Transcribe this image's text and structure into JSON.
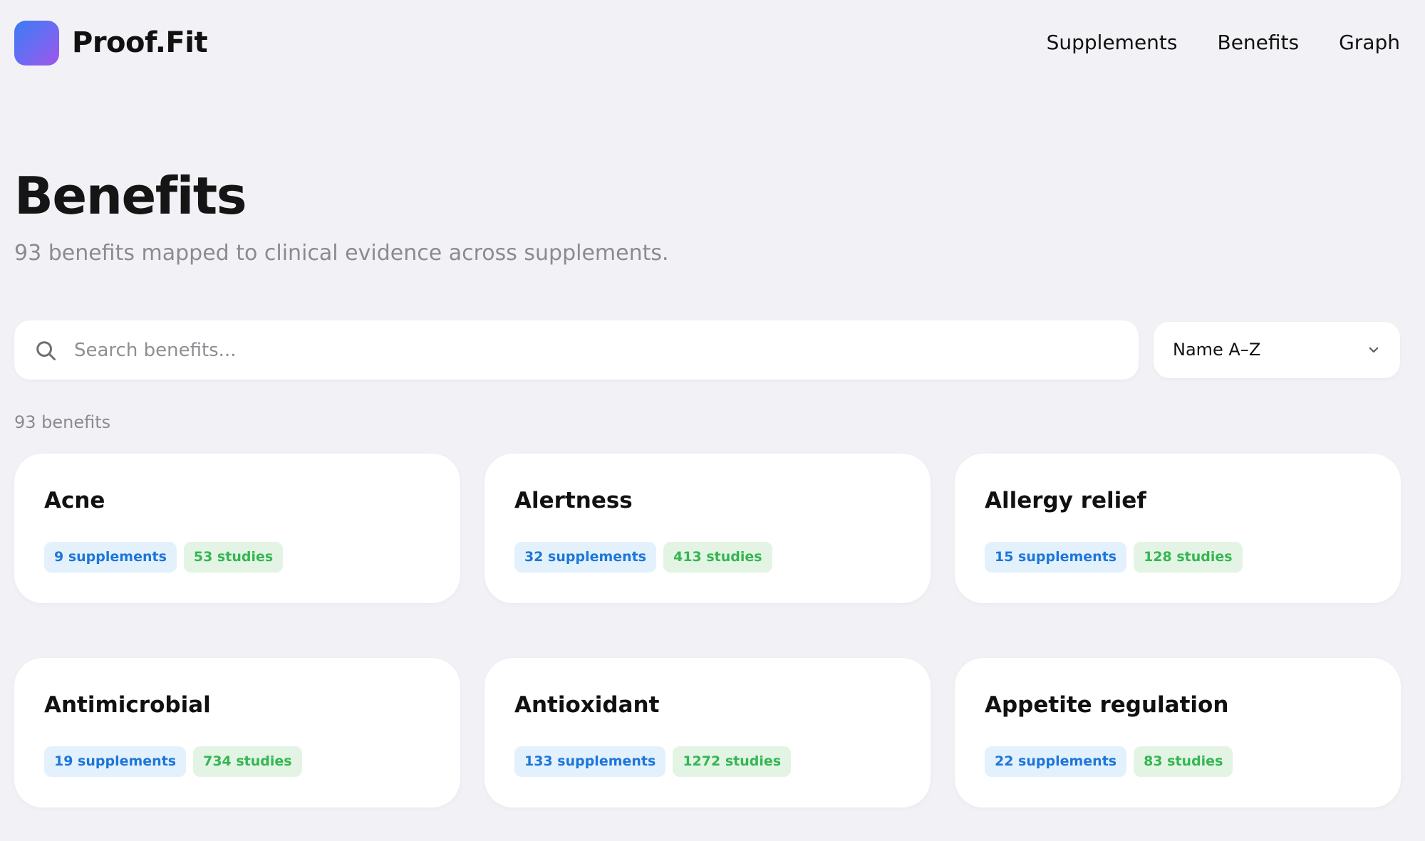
{
  "header": {
    "brand": "Proof.Fit",
    "nav": [
      {
        "label": "Supplements"
      },
      {
        "label": "Benefits"
      },
      {
        "label": "Graph"
      }
    ]
  },
  "page": {
    "title": "Benefits",
    "subtitle": "93 benefits mapped to clinical evidence across supplements."
  },
  "search": {
    "placeholder": "Search benefits...",
    "value": ""
  },
  "sort": {
    "selected": "Name A–Z"
  },
  "results": {
    "count_label": "93 benefits"
  },
  "cards": [
    {
      "title": "Acne",
      "supplements": "9 supplements",
      "studies": "53 studies"
    },
    {
      "title": "Alertness",
      "supplements": "32 supplements",
      "studies": "413 studies"
    },
    {
      "title": "Allergy relief",
      "supplements": "15 supplements",
      "studies": "128 studies"
    },
    {
      "title": "Antimicrobial",
      "supplements": "19 supplements",
      "studies": "734 studies"
    },
    {
      "title": "Antioxidant",
      "supplements": "133 supplements",
      "studies": "1272 studies"
    },
    {
      "title": "Appetite regulation",
      "supplements": "22 supplements",
      "studies": "83 studies"
    }
  ],
  "colors": {
    "background": "#f2f2f6",
    "supplement_badge_bg": "#e3f1fd",
    "supplement_badge_text": "#1d76d9",
    "study_badge_bg": "#e3f4e5",
    "study_badge_text": "#34b651",
    "logo_gradient": [
      "#3d7bf5",
      "#a155ea"
    ]
  },
  "icons": {
    "search": "search-icon",
    "sort": "chevron-down-icon",
    "logo": "logo-icon"
  }
}
